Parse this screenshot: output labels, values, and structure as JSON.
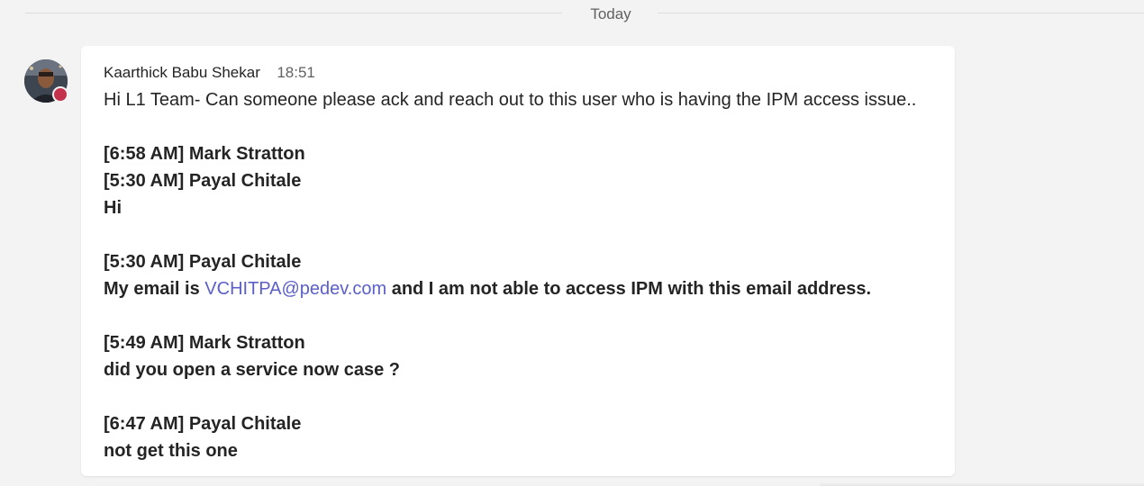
{
  "divider": {
    "label": "Today"
  },
  "message": {
    "author": "Kaarthick Babu Shekar",
    "time": "18:51",
    "intro": "Hi L1 Team- Can someone please ack and reach out to this user who is having the IPM access issue..",
    "lines": {
      "l1": "[6:58 AM] Mark Stratton",
      "l2": "[5:30 AM] Payal Chitale",
      "l3": "Hi",
      "l4": "[5:30 AM] Payal Chitale",
      "l5_prefix": "My email is ",
      "l5_email": "VCHITPA@pedev.com",
      "l5_suffix": " and I am not able to access IPM with this email address.",
      "l6": "[5:49 AM] Mark Stratton",
      "l7": "did you open a service now case ?",
      "l8": "[6:47 AM] Payal Chitale",
      "l9": "not get this one"
    }
  },
  "presence": {
    "status_color": "#c4314b"
  },
  "colors": {
    "link": "#5b5fc7",
    "background": "#f3f3f3",
    "card": "#ffffff"
  }
}
